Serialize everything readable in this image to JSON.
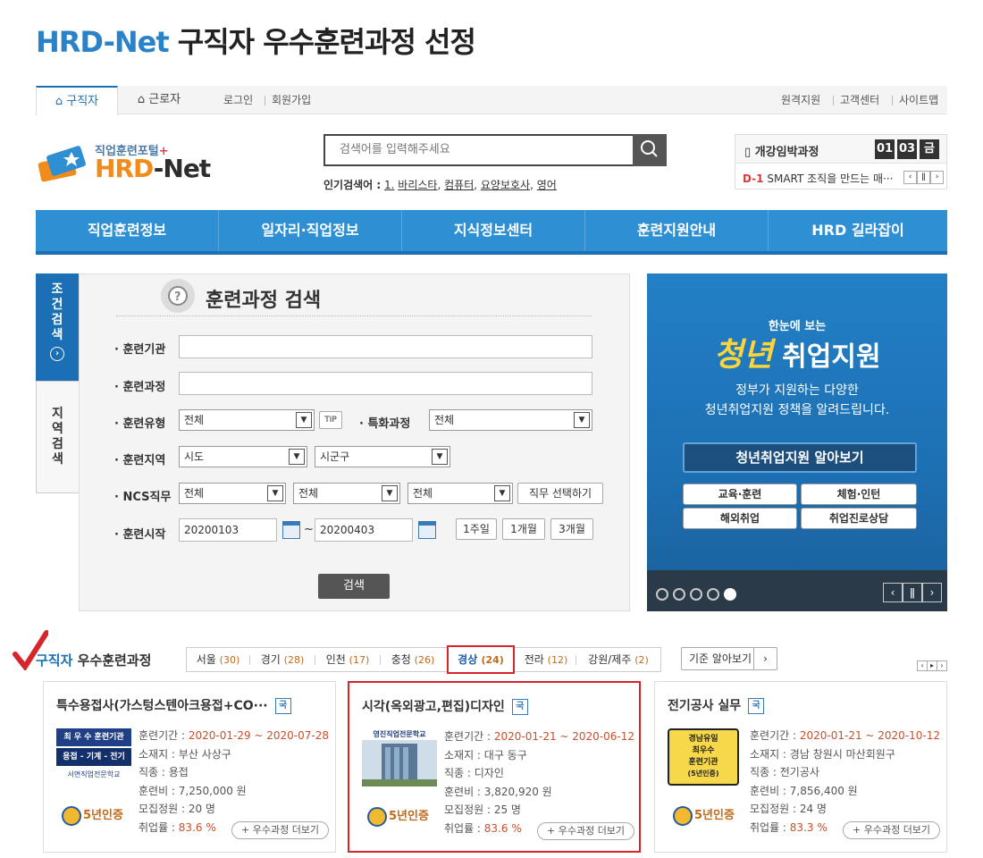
{
  "page_title": {
    "brand": "HRD-Net",
    "rest": "구직자 우수훈련과정 선정"
  },
  "topbar": {
    "tabs": [
      "구직자",
      "근로자"
    ],
    "links_left": [
      "로그인",
      "회원가입"
    ],
    "links_right": [
      "원격지원",
      "고객센터",
      "사이트맵"
    ]
  },
  "logo": {
    "sub": "직업훈련포털",
    "main_a": "HRD",
    "main_b": "-Net"
  },
  "search": {
    "placeholder": "검색어를 입력해주세요",
    "popular_label": "인기검색어 :",
    "popular": [
      "1.",
      "바리스타",
      "컴퓨터",
      "요양보호사",
      "영어"
    ]
  },
  "widget": {
    "title": "개강임박과정",
    "month": "01",
    "day": "03",
    "weekday": "금",
    "dday": "D-1",
    "course": "SMART 조직을 만드는 매···"
  },
  "gnb": [
    "직업훈련정보",
    "일자리·직업정보",
    "지식정보센터",
    "훈련지원안내",
    "HRD 길라잡이"
  ],
  "side_tabs": {
    "condition": [
      "조",
      "건",
      "검",
      "색"
    ],
    "region": [
      "지",
      "역",
      "검",
      "색"
    ]
  },
  "search_panel": {
    "title": "훈련과정 검색",
    "labels": [
      "· 훈련기관",
      "· 훈련과정",
      "· 훈련유형",
      "· 특화과정",
      "· 훈련지역",
      "· NCS직무",
      "· 훈련시작"
    ],
    "type_value": "전체",
    "tip": "TIP",
    "special_value": "전체",
    "region_sido": "시도",
    "region_sigungu": "시군구",
    "ncs": [
      "전체",
      "전체",
      "전체"
    ],
    "ncs_btn": "직무 선택하기",
    "date_from": "20200103",
    "date_tilde": "~",
    "date_to": "20200403",
    "periods": [
      "1주일",
      "1개월",
      "3개월"
    ],
    "submit": "검색"
  },
  "banner": {
    "small": "한눈에 보는",
    "big_a": "청년",
    "big_b": "취업지원",
    "desc1": "정부가 지원하는 다양한",
    "desc2": "청년취업지원 정책을 알려드립니다.",
    "main_btn": "청년취업지원 알아보기",
    "subs": [
      "교육·훈련",
      "체험·인턴",
      "해외취업",
      "취업진로상담"
    ]
  },
  "region_section": {
    "title_a": "구직자",
    "title_b": "우수훈련과정",
    "regions": [
      {
        "name": "서울",
        "count": "(30)"
      },
      {
        "name": "경기",
        "count": "(28)"
      },
      {
        "name": "인천",
        "count": "(17)"
      },
      {
        "name": "충청",
        "count": "(26)"
      },
      {
        "name": "경상",
        "count": "(24)"
      },
      {
        "name": "전라",
        "count": "(12)"
      },
      {
        "name": "강원/제주",
        "count": "(2)"
      }
    ],
    "criteria_btn": "기준 알아보기",
    "criteria_arrow": "›"
  },
  "cards": [
    {
      "title": "특수용접사(가스텅스텐아크용접+CO···",
      "badge": "국",
      "period_label": "훈련기간 : ",
      "period": "2020-01-29 ~ 2020-07-28",
      "location": "소재지 : 부산 사상구",
      "job": "직종 : 용접",
      "fee": "훈련비 : 7,250,000 원",
      "quota": "모집정원 : 20 명",
      "emp_label": "취업률 : ",
      "emp": "83.6 %",
      "img_lines": [
        "최 우 수 훈련기관",
        "용접 - 기계 - 전기",
        "서면직업전문학교"
      ],
      "cert": "5년인증",
      "more": "+ 우수과정 더보기"
    },
    {
      "title": "시각(옥외광고,편집)디자인",
      "badge": "국",
      "period_label": "훈련기간 : ",
      "period": "2020-01-21 ~ 2020-06-12",
      "location": "소재지 : 대구 동구",
      "job": "직종 : 디자인",
      "fee": "훈련비 : 3,820,920 원",
      "quota": "모집정원 : 25 명",
      "emp_label": "취업률 : ",
      "emp": "83.6 %",
      "img_lines": [
        "영진직업전문학교"
      ],
      "cert": "5년인증",
      "more": "+ 우수과정 더보기"
    },
    {
      "title": "전기공사 실무",
      "badge": "국",
      "period_label": "훈련기간 : ",
      "period": "2020-01-21 ~ 2020-10-12",
      "location": "소재지 : 경남 창원시 마산회원구",
      "job": "직종 : 전기공사",
      "fee": "훈련비 : 7,856,400 원",
      "quota": "모집정원 : 24 명",
      "emp_label": "취업률 : ",
      "emp": "83.3 %",
      "img_lines": [
        "경남유일",
        "최우수",
        "훈련기관",
        "(5년인증)"
      ],
      "cert": "5년인증",
      "more": "+ 우수과정 더보기"
    }
  ],
  "colors": {
    "brand_blue": "#2a82c8",
    "gnb_blue": "#2f8fd3",
    "highlight_red": "#d7262b",
    "accent_orange": "#c06a1a"
  }
}
